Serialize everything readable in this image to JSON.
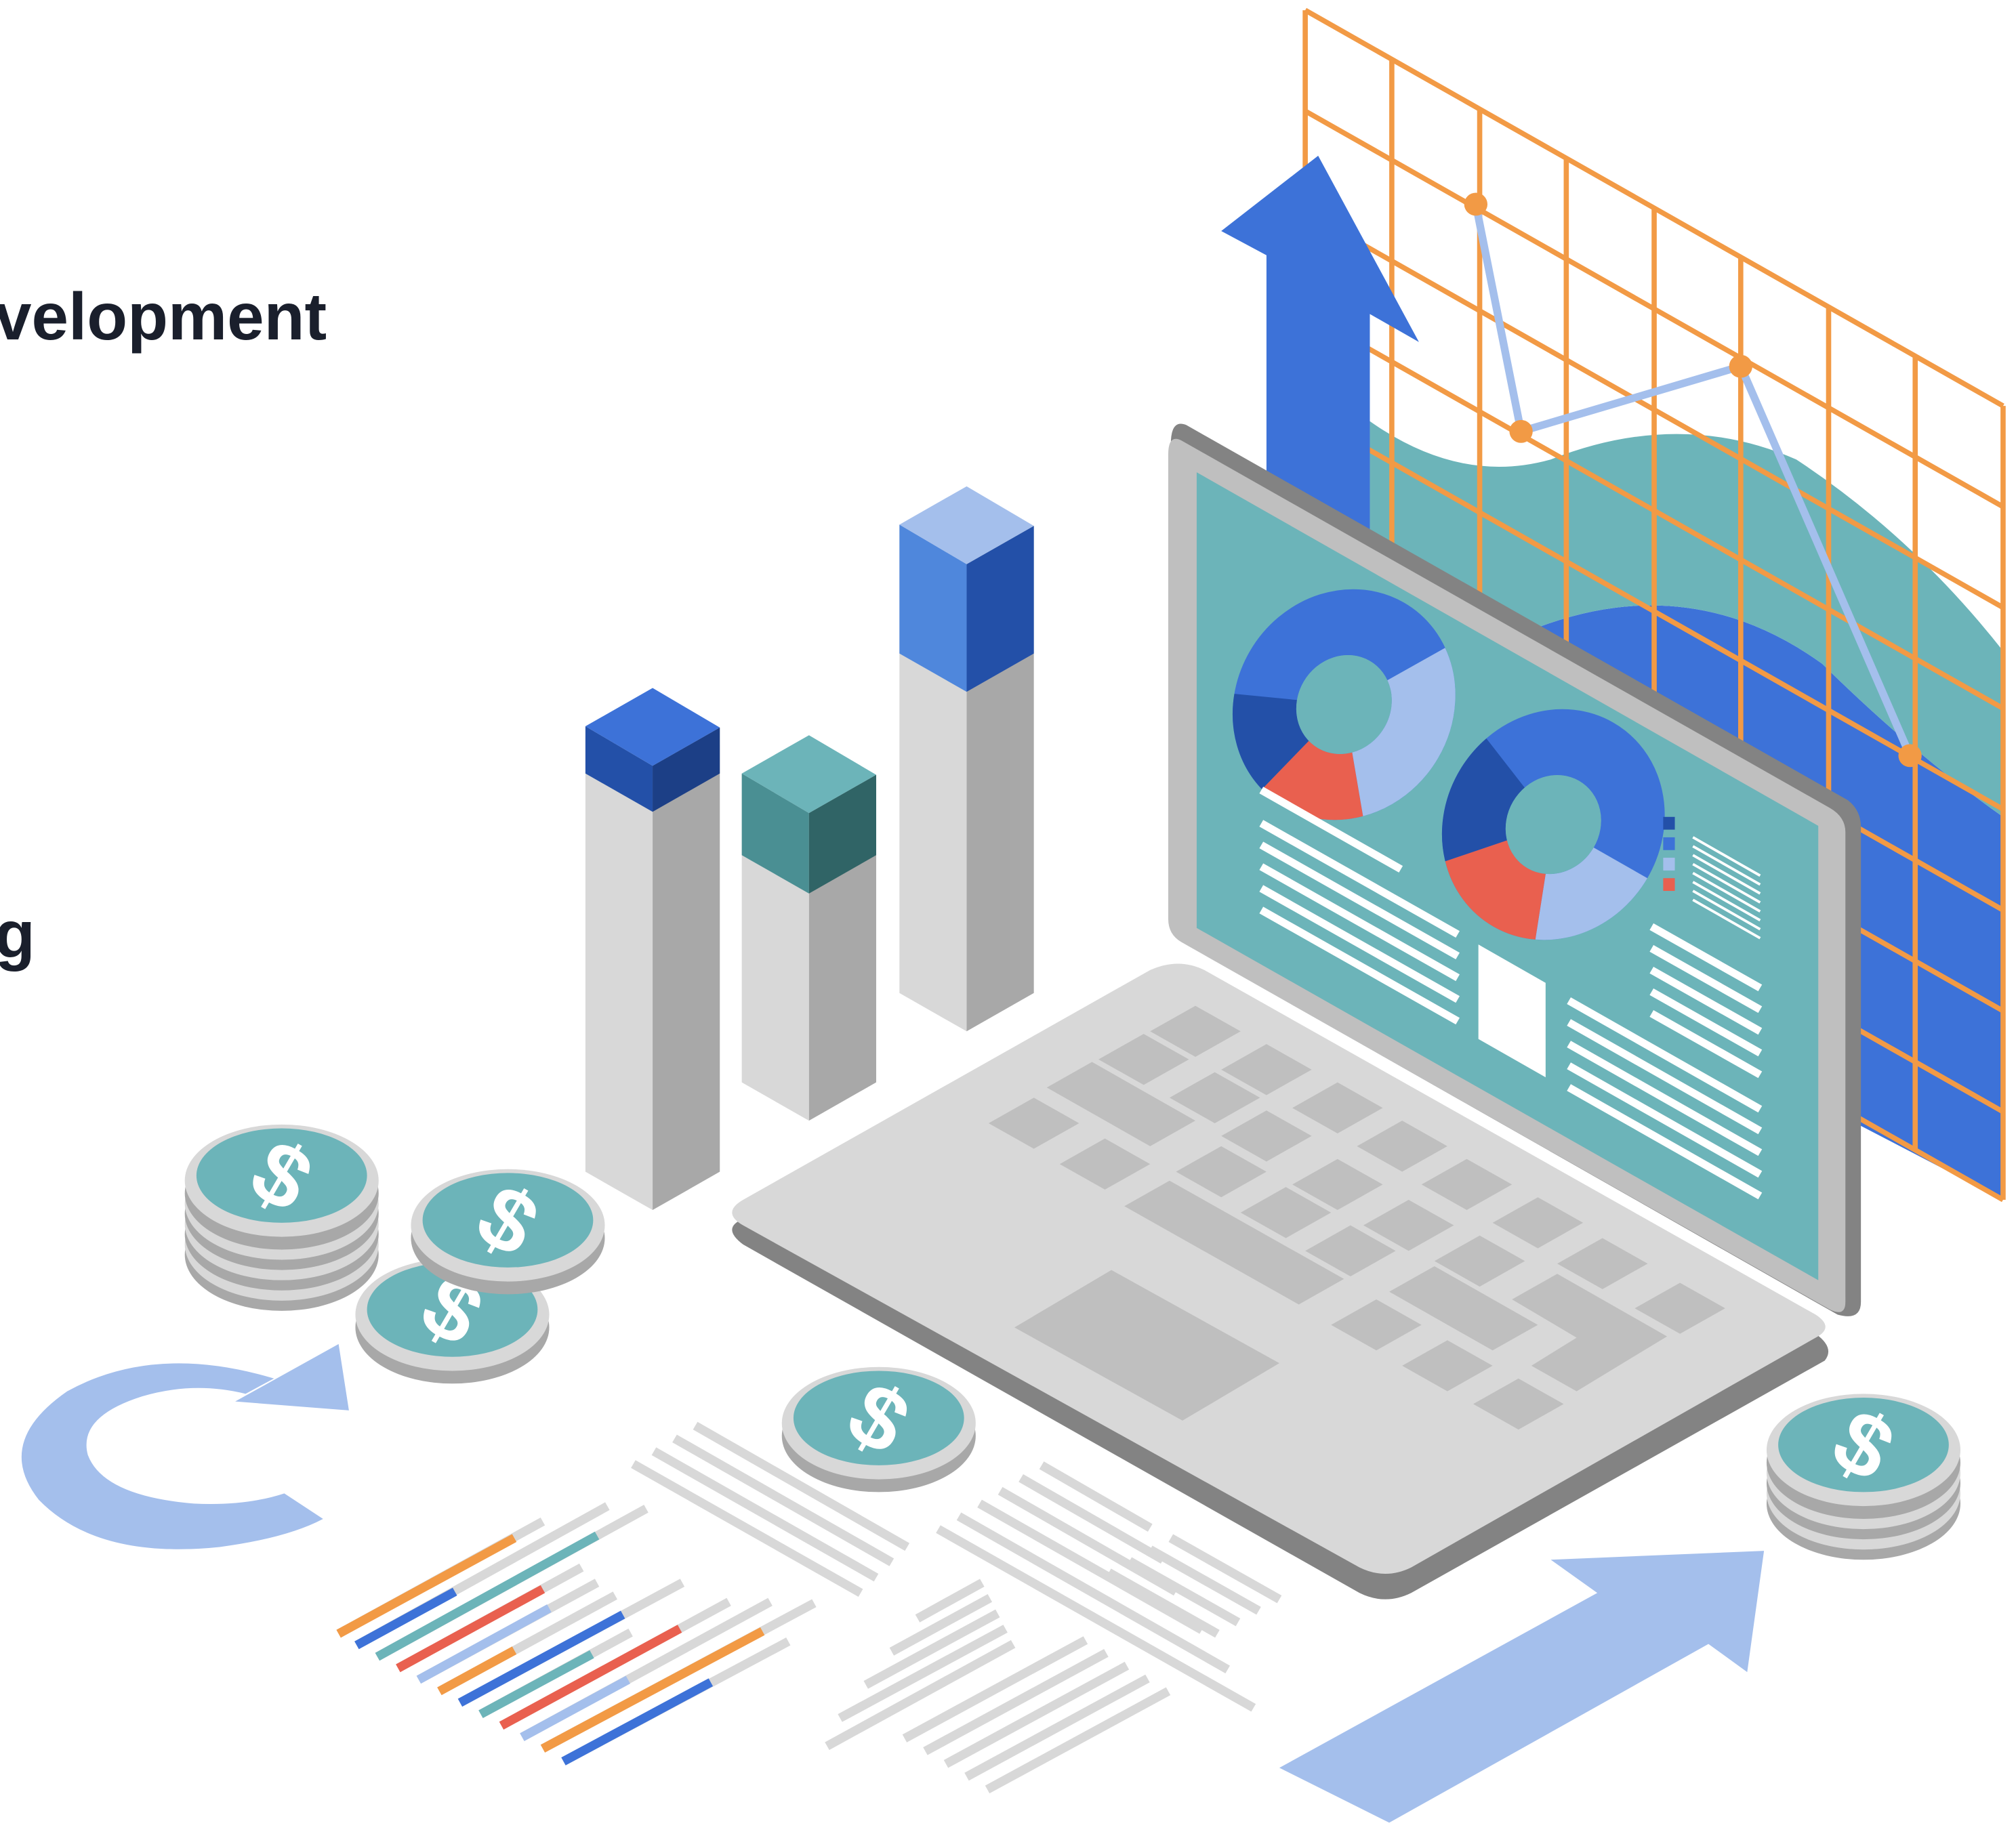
{
  "headings": {
    "line_1": "velopment",
    "line_2": "g"
  },
  "coin_symbol": "$",
  "icons": [
    "dollar-coin-icon",
    "refresh-arrow-icon",
    "up-arrow-icon",
    "laptop-icon",
    "bar-chart-icon",
    "donut-chart-icon",
    "line-chart-grid-icon"
  ],
  "colors": {
    "blue": "#3d72d8",
    "dark_blue": "#2350a8",
    "navy": "#1c3f86",
    "light_blue": "#a4bfec",
    "teal": "#6cb4b9",
    "dark_teal": "#4a8f93",
    "deep_teal": "#306466",
    "orange": "#f29a45",
    "red": "#e9604f",
    "light_gray": "#d8d8d8",
    "mid_gray": "#a8a8a8",
    "dark_gray": "#838383",
    "key_gray": "#bfbfbf"
  }
}
